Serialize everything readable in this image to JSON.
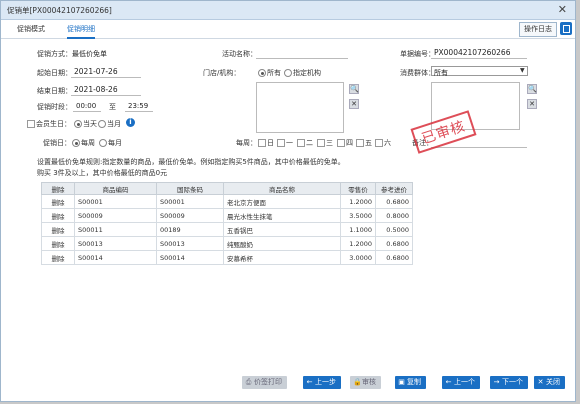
{
  "window": {
    "title": "促销单[PX00042107260266]",
    "close": "✕"
  },
  "tabs": [
    {
      "label": "促销模式"
    },
    {
      "label": "促销明细"
    }
  ],
  "toolbar": {
    "op_log": "操作日志"
  },
  "form": {
    "promo_mode_label": "促销方式：",
    "promo_mode_value": "最低价免单",
    "start_label": "起始日期：",
    "start_value": "2021-07-26",
    "end_label": "结束日期：",
    "end_value": "2021-08-26",
    "time_label": "促销时段：",
    "time_from": "00:00",
    "time_to_label": "至",
    "time_to": "23:59",
    "member_bday_label": "会员生日：",
    "bday_today": "当天",
    "bday_month": "当月",
    "promo_day_label": "促销日：",
    "promo_day_weekly": "每周",
    "promo_day_monthly": "每月",
    "activity_label": "活动名称：",
    "store_label": "门店/机构：",
    "store_all": "所有",
    "store_specified": "指定机构",
    "doc_no_label": "单据编号：",
    "doc_no_value": "PX00042107260266",
    "consumer_label": "消费群体：",
    "consumer_value": "所有",
    "weekly_label": "每周：",
    "weekdays": [
      "日",
      "一",
      "二",
      "三",
      "四",
      "五",
      "六"
    ],
    "remark_label": "备注：",
    "stamp_text": "已审核"
  },
  "description": {
    "line1": "设置最低价免单规则:指定数量的商品，最低价免单。例如指定购买5件商品，其中价格最低的免单。",
    "line2": "购买 3件及以上，其中价格最低的商品0元"
  },
  "table": {
    "headers": [
      "删除",
      "商品编码",
      "国际条码",
      "商品名称",
      "零售价",
      "参考进价"
    ],
    "rows": [
      [
        "删除",
        "S00001",
        "S00001",
        "老北京方便面",
        "1.2000",
        "0.6800"
      ],
      [
        "删除",
        "S00009",
        "S00009",
        "晨光水性生抹笔",
        "3.5000",
        "0.8000"
      ],
      [
        "删除",
        "S00011",
        "00189",
        "五香锅巴",
        "1.1000",
        "0.5000"
      ],
      [
        "删除",
        "S00013",
        "S00013",
        "纯甄酸奶",
        "1.2000",
        "0.6800"
      ],
      [
        "删除",
        "S00014",
        "S00014",
        "安慕希杯",
        "3.0000",
        "0.6800"
      ]
    ]
  },
  "buttons": {
    "price_print": "价签打印",
    "prev_step": "上一步",
    "audit": "审核",
    "copy": "复制",
    "prev": "上一个",
    "next": "下一个",
    "close": "关闭"
  }
}
